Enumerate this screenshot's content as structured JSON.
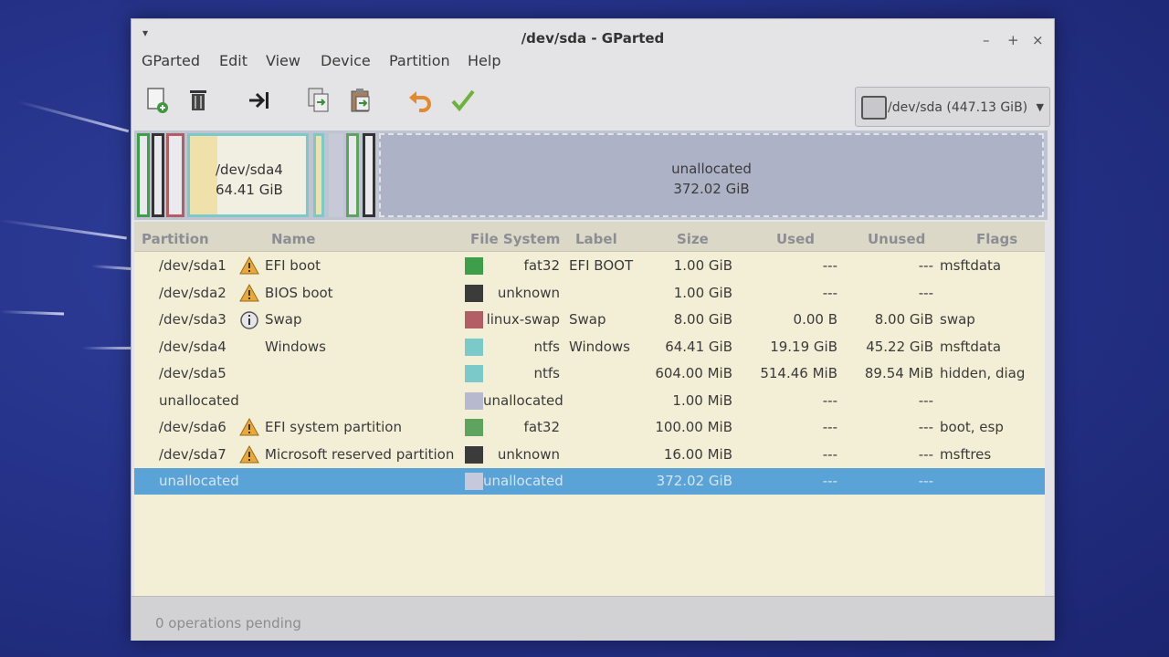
{
  "window": {
    "title": "/dev/sda - GParted",
    "controls": [
      "–",
      "+",
      "×"
    ],
    "menu_glyph": "▾"
  },
  "menubar": {
    "items": [
      "GParted",
      "Edit",
      "View",
      "Device",
      "Partition",
      "Help"
    ]
  },
  "toolbar": {
    "tools": [
      "new-partition-icon",
      "delete-icon",
      "resize-move-icon",
      "copy-icon",
      "paste-icon",
      "undo-icon",
      "apply-icon"
    ]
  },
  "device_selector": {
    "label": "/dev/sda (447.13 GiB)",
    "arrow": "▼",
    "icon": "hard-disk-icon"
  },
  "disk_map": {
    "sda4_name": "/dev/sda4",
    "sda4_size": "64.41 GiB",
    "unalloc_name": "unallocated",
    "unalloc_size": "372.02 GiB"
  },
  "table": {
    "columns": [
      "Partition",
      "Name",
      "File System",
      "Label",
      "Size",
      "Used",
      "Unused",
      "Flags"
    ],
    "rows": [
      {
        "partition": "/dev/sda1",
        "icon": "warning-icon",
        "name": "EFI boot",
        "fs_color": "#3f9e4a",
        "filesystem": "fat32",
        "label": "EFI BOOT",
        "size": "1.00 GiB",
        "used": "---",
        "unused": "---",
        "flags": "msftdata"
      },
      {
        "partition": "/dev/sda2",
        "icon": "warning-icon",
        "name": "BIOS boot",
        "fs_color": "#3b3b3b",
        "filesystem": "unknown",
        "label": "",
        "size": "1.00 GiB",
        "used": "---",
        "unused": "---",
        "flags": ""
      },
      {
        "partition": "/dev/sda3",
        "icon": "info-icon",
        "name": "Swap",
        "fs_color": "#b25e64",
        "filesystem": "linux-swap",
        "label": "Swap",
        "size": "8.00 GiB",
        "used": "0.00 B",
        "unused": "8.00 GiB",
        "flags": "swap"
      },
      {
        "partition": "/dev/sda4",
        "icon": "",
        "name": "Windows",
        "fs_color": "#7cc9c9",
        "filesystem": "ntfs",
        "label": "Windows",
        "size": "64.41 GiB",
        "used": "19.19 GiB",
        "unused": "45.22 GiB",
        "flags": "msftdata"
      },
      {
        "partition": "/dev/sda5",
        "icon": "",
        "name": "",
        "fs_color": "#7cc9c9",
        "filesystem": "ntfs",
        "label": "",
        "size": "604.00 MiB",
        "used": "514.46 MiB",
        "unused": "89.54 MiB",
        "flags": "hidden, diag"
      },
      {
        "partition": "unallocated",
        "icon": "",
        "name": "",
        "fs_color": "#b7b9cf",
        "filesystem": "unallocated",
        "label": "",
        "size": "1.00 MiB",
        "used": "---",
        "unused": "---",
        "flags": ""
      },
      {
        "partition": "/dev/sda6",
        "icon": "warning-icon",
        "name": "EFI system partition",
        "fs_color": "#5ea45e",
        "filesystem": "fat32",
        "label": "",
        "size": "100.00 MiB",
        "used": "---",
        "unused": "---",
        "flags": "boot, esp"
      },
      {
        "partition": "/dev/sda7",
        "icon": "warning-icon",
        "name": "Microsoft reserved partition",
        "fs_color": "#3b3b3b",
        "filesystem": "unknown",
        "label": "",
        "size": "16.00 MiB",
        "used": "---",
        "unused": "---",
        "flags": "msftres"
      },
      {
        "partition": "unallocated",
        "icon": "",
        "name": "",
        "fs_color": "#c6c8dc",
        "filesystem": "unallocated",
        "label": "",
        "size": "372.02 GiB",
        "used": "---",
        "unused": "---",
        "flags": "",
        "selected": true
      }
    ]
  },
  "statusbar": {
    "text": "0 operations pending"
  }
}
